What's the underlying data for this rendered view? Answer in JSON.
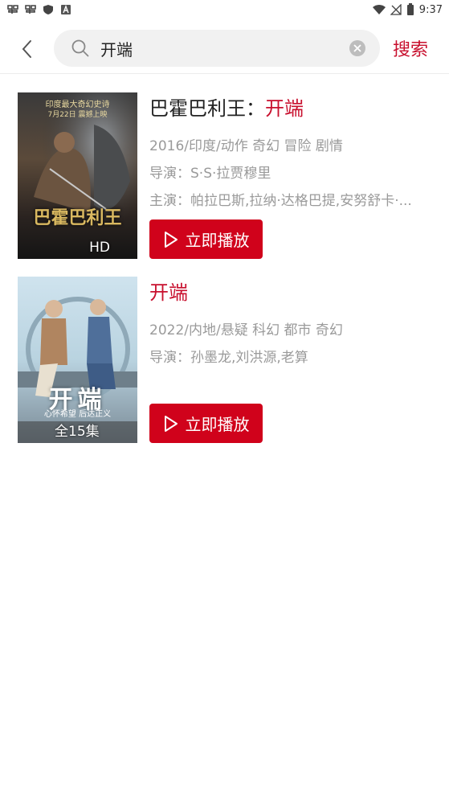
{
  "status_bar": {
    "time": "9:37",
    "left_icons": [
      "app-icon",
      "app-icon",
      "shield-icon",
      "a-icon"
    ],
    "right_icons": [
      "wifi-icon",
      "no-signal-icon",
      "battery-icon"
    ]
  },
  "header": {
    "search_value": "开端",
    "search_button": "搜索"
  },
  "results": [
    {
      "title_prefix": "巴霍巴利王：",
      "title_highlight": "开端",
      "info": "2016/印度/动作 奇幻 冒险 剧情",
      "director": "导演：S·S·拉贾穆里",
      "cast": "主演：帕拉巴斯,拉纳·达格巴提,安努舒卡·...",
      "badge": "HD",
      "play_label": "立即播放",
      "poster_text": "巴霍巴利王",
      "poster_top_text": "印度最大奇幻史诗",
      "poster_date": "7月22日 震撼上映"
    },
    {
      "title_highlight": "开端",
      "info": "2022/内地/悬疑 科幻 都市 奇幻",
      "director": "导演：孙墨龙,刘洪源,老算",
      "badge": "全15集",
      "play_label": "立即播放",
      "poster_text": "开端",
      "poster_slogan": "心怀希望  后达正义"
    }
  ],
  "colors": {
    "accent": "#c8102e",
    "play_button": "#d0021b",
    "meta_text": "#9a9a9a"
  }
}
